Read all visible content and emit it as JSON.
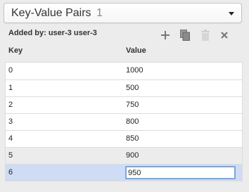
{
  "header": {
    "title": "Key-Value Pairs",
    "count": "1"
  },
  "added_by": "Added by: user-3 user-3",
  "toolbar": {
    "icons": [
      "plus-icon",
      "copy-icon",
      "trash-icon",
      "close-icon"
    ]
  },
  "columns": {
    "key": "Key",
    "value": "Value"
  },
  "rows": [
    {
      "key": "0",
      "value": "1000"
    },
    {
      "key": "1",
      "value": "500"
    },
    {
      "key": "2",
      "value": "750"
    },
    {
      "key": "3",
      "value": "800"
    },
    {
      "key": "4",
      "value": "850"
    },
    {
      "key": "5",
      "value": "900"
    },
    {
      "key": "6",
      "value": "950"
    }
  ],
  "colors": {
    "selected_row": "#cfdcf5",
    "input_border": "#7aa7e0"
  }
}
